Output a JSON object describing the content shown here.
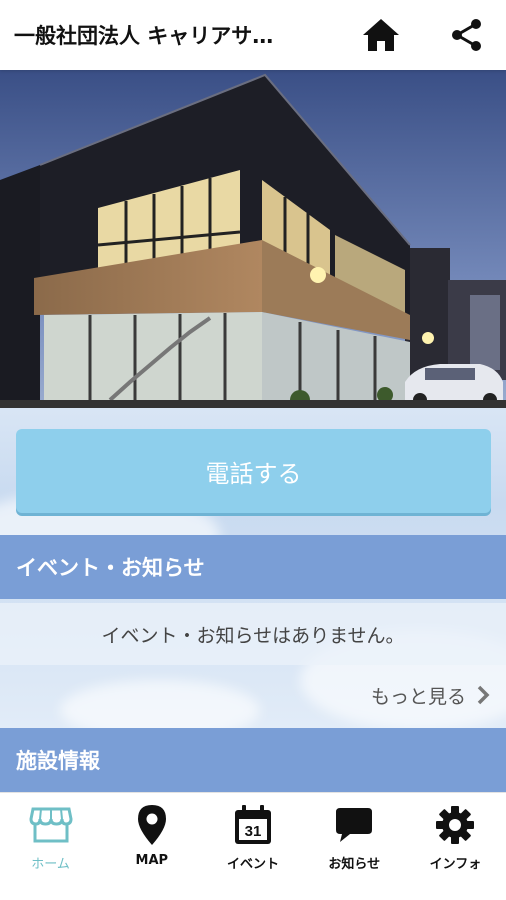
{
  "app_bar": {
    "title": "一般社団法人 キャリアサ…",
    "home_icon": "home-icon",
    "share_icon": "share-icon"
  },
  "hero": {
    "description": "Exterior photo of a two-story glass and wood building at dusk"
  },
  "call_button": {
    "label": "電話する"
  },
  "events": {
    "header": "イベント・お知らせ",
    "empty_message": "イベント・お知らせはありません。",
    "more_label": "もっと見る"
  },
  "facility": {
    "header": "施設情報"
  },
  "tabs": [
    {
      "label": "ホーム",
      "icon": "store-icon",
      "active": true
    },
    {
      "label": "MAP",
      "icon": "map-pin-icon",
      "active": false
    },
    {
      "label": "イベント",
      "icon": "calendar-icon",
      "calendar_day": "31",
      "active": false
    },
    {
      "label": "お知らせ",
      "icon": "chat-bubble-icon",
      "active": false
    },
    {
      "label": "インフォ",
      "icon": "gear-icon",
      "active": false
    }
  ],
  "colors": {
    "call_button": "#8ecfec",
    "section_header": "#7a9ed6",
    "active_tab": "#6fbfc6"
  }
}
